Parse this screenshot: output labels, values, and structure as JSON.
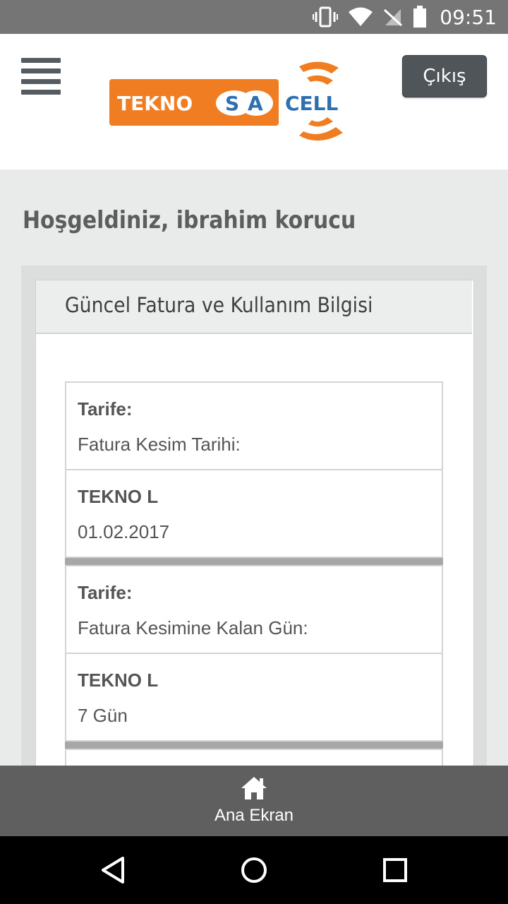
{
  "status_bar": {
    "time": "09:51",
    "icons": [
      "vibrate-icon",
      "wifi-icon",
      "no-sim-icon",
      "battery-icon"
    ]
  },
  "header": {
    "logo_text_left": "TEKNOSA",
    "logo_text_right": "CELL",
    "logout_label": "Çıkış"
  },
  "welcome": "Hoşgeldiniz, ibrahim korucu",
  "card": {
    "title": "Güncel Fatura ve Kullanım Bilgisi",
    "blocks": [
      {
        "label_head": "Tarife:",
        "label_sub": "Fatura Kesim Tarihi:",
        "value_head": "TEKNO L",
        "value_sub": "01.02.2017"
      },
      {
        "label_head": "Tarife:",
        "label_sub": "Fatura Kesimine Kalan Gün:",
        "value_head": "TEKNO L",
        "value_sub": "7 Gün"
      }
    ]
  },
  "bottom_nav": {
    "home_label": "Ana Ekran"
  },
  "colors": {
    "brand_orange": "#f07d22",
    "brand_blue": "#2d6fb0",
    "bar_gray": "#5f5f5f",
    "status_gray": "#757575"
  }
}
